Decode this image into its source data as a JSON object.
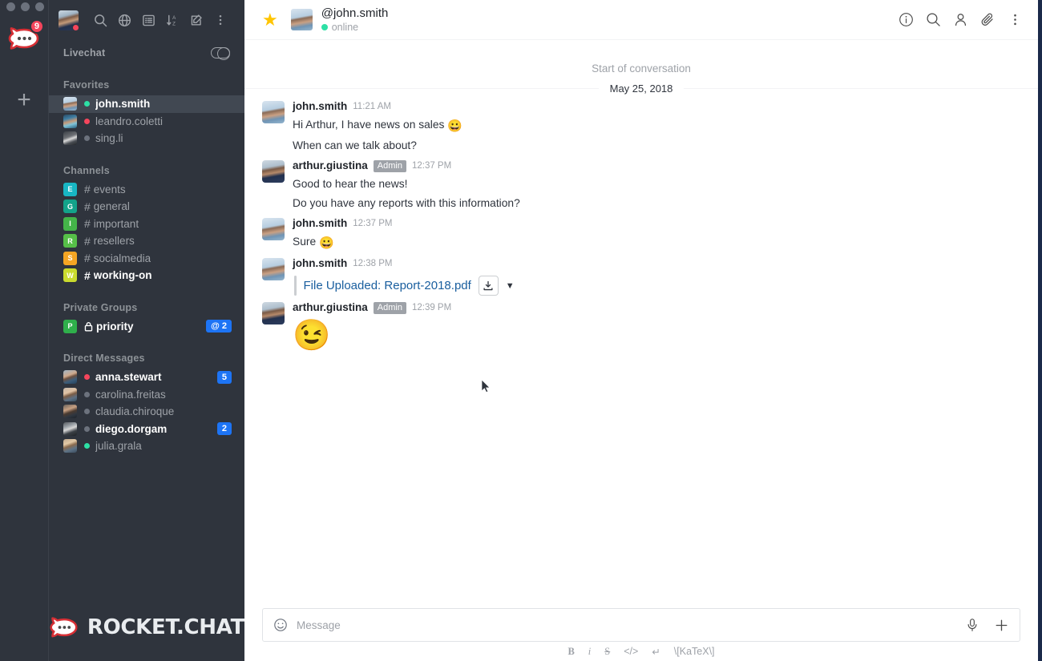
{
  "window": {
    "traffic_lights": 3
  },
  "rail": {
    "logo_name": "rocket-chat-logo",
    "unread_badge": "9",
    "add_label": "+"
  },
  "sidebar": {
    "toolbar": {
      "avatar_name": "current-user-avatar",
      "icons": [
        "search-icon",
        "directory-globe-icon",
        "discussions-list-icon",
        "sort-az-icon",
        "create-new-icon",
        "kebab-menu-icon"
      ]
    },
    "livechat": {
      "label": "Livechat",
      "toggle_state": "off"
    },
    "sections": [
      {
        "title": "Favorites",
        "rooms": [
          {
            "name": "john.smith",
            "type": "dm",
            "status": "online",
            "active": true,
            "unread": false,
            "badge": ""
          },
          {
            "name": "leandro.coletti",
            "type": "dm",
            "status": "busy",
            "active": false,
            "unread": false,
            "badge": ""
          },
          {
            "name": "sing.li",
            "type": "dm",
            "status": "offline",
            "active": false,
            "unread": false,
            "badge": ""
          }
        ]
      },
      {
        "title": "Channels",
        "rooms": [
          {
            "name": "events",
            "type": "channel",
            "initial": "E",
            "color": "#18b6c4",
            "unread": false,
            "badge": ""
          },
          {
            "name": "general",
            "type": "channel",
            "initial": "G",
            "color": "#13a38a",
            "unread": false,
            "badge": ""
          },
          {
            "name": "important",
            "type": "channel",
            "initial": "I",
            "color": "#44b449",
            "unread": false,
            "badge": ""
          },
          {
            "name": "resellers",
            "type": "channel",
            "initial": "R",
            "color": "#56bf48",
            "unread": false,
            "badge": ""
          },
          {
            "name": "socialmedia",
            "type": "channel",
            "initial": "S",
            "color": "#f5a523",
            "unread": false,
            "badge": ""
          },
          {
            "name": "working-on",
            "type": "channel",
            "initial": "W",
            "color": "#cadb2e",
            "unread": true,
            "badge": ""
          }
        ]
      },
      {
        "title": "Private Groups",
        "rooms": [
          {
            "name": "priority",
            "type": "private",
            "initial": "P",
            "color": "#2faf4b",
            "unread": true,
            "badge": "@ 2"
          }
        ]
      },
      {
        "title": "Direct Messages",
        "rooms": [
          {
            "name": "anna.stewart",
            "type": "dm",
            "status": "busy",
            "unread": true,
            "badge": "5"
          },
          {
            "name": "carolina.freitas",
            "type": "dm",
            "status": "offline",
            "unread": false,
            "badge": ""
          },
          {
            "name": "claudia.chiroque",
            "type": "dm",
            "status": "offline",
            "unread": false,
            "badge": ""
          },
          {
            "name": "diego.dorgam",
            "type": "dm",
            "status": "offline",
            "unread": true,
            "badge": "2"
          },
          {
            "name": "julia.grala",
            "type": "dm",
            "status": "online",
            "unread": false,
            "badge": ""
          }
        ]
      }
    ],
    "footer": {
      "brand": "ROCKET.CHAT"
    }
  },
  "chat": {
    "header": {
      "favorite_icon": "star-icon",
      "favorite_state": "on",
      "title": "@john.smith",
      "status_text": "online",
      "status_color": "#2de0a5",
      "actions": [
        "info-icon",
        "search-icon",
        "members-icon",
        "attachment-icon",
        "kebab-menu-icon"
      ]
    },
    "start_of_conversation": "Start of conversation",
    "date_divider": "May 25, 2018",
    "messages": [
      {
        "user": "john.smith",
        "role": "",
        "time": "11:21 AM",
        "avatar": "ph-js",
        "lines": [
          {
            "text": "Hi Arthur, I have news on sales ",
            "emoji": "😀"
          },
          {
            "text": "When can we talk about?",
            "emoji": ""
          }
        ]
      },
      {
        "user": "arthur.giustina",
        "role": "Admin",
        "time": "12:37 PM",
        "avatar": "ph-ag",
        "lines": [
          {
            "text": "Good to hear the news!",
            "emoji": ""
          },
          {
            "text": "Do you have any reports with this information?",
            "emoji": ""
          }
        ]
      },
      {
        "user": "john.smith",
        "role": "",
        "time": "12:37 PM",
        "avatar": "ph-js",
        "lines": [
          {
            "text": "Sure ",
            "emoji": "😀"
          }
        ]
      },
      {
        "user": "john.smith",
        "role": "",
        "time": "12:38 PM",
        "avatar": "ph-js",
        "attachment": {
          "title": "File Uploaded: Report-2018.pdf",
          "download_icon": "download-icon",
          "caret_icon": "chevron-down-icon"
        },
        "lines": []
      },
      {
        "user": "arthur.giustina",
        "role": "Admin",
        "time": "12:39 PM",
        "avatar": "ph-ag",
        "big_emoji": "😉",
        "lines": []
      }
    ]
  },
  "composer": {
    "emoji_icon": "emoji-smiley-icon",
    "placeholder": "Message",
    "value": "",
    "mic_icon": "microphone-icon",
    "plus_icon": "plus-icon",
    "format_buttons": [
      {
        "name": "bold",
        "label": "B"
      },
      {
        "name": "italic",
        "label": "i"
      },
      {
        "name": "strike",
        "label": "S"
      },
      {
        "name": "code",
        "label": "</>"
      },
      {
        "name": "newline",
        "label": "↵"
      },
      {
        "name": "katex",
        "label": "\\[KaTeX\\]"
      }
    ]
  },
  "colors": {
    "sidebar_bg": "#2f343d",
    "sidebar_active": "#414852",
    "badge_blue": "#1d74f5",
    "link_blue": "#195e9e",
    "star_gold": "#ffc502",
    "online_green": "#2de0a5",
    "busy_red": "#f5455c",
    "desktop_navy": "#1b2a4a"
  }
}
